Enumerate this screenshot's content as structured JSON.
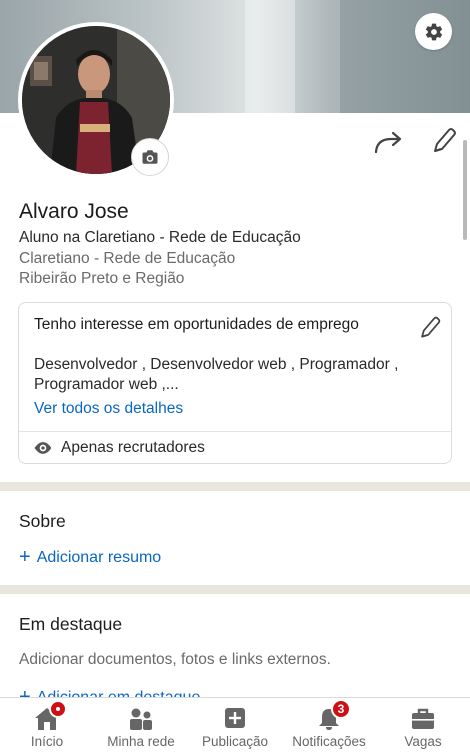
{
  "profile": {
    "name": "Alvaro Jose",
    "headline": "Aluno na Claretiano - Rede de Educação",
    "organization": "Claretiano - Rede de Educação",
    "location": "Ribeirão Preto e Região"
  },
  "open_to_work": {
    "title": "Tenho interesse em oportunidades de emprego",
    "roles": "Desenvolvedor , Desenvolvedor web , Programador , Programador web ,...",
    "details_link": "Ver todos os detalhes",
    "visibility": "Apenas recrutadores"
  },
  "about": {
    "title": "Sobre",
    "add_label": "Adicionar resumo"
  },
  "featured": {
    "title": "Em destaque",
    "description": "Adicionar documentos, fotos e links externos.",
    "add_label": "Adicionar em destaque"
  },
  "nav": {
    "items": [
      {
        "label": "Início",
        "icon": "home-icon"
      },
      {
        "label": "Minha rede",
        "icon": "network-icon"
      },
      {
        "label": "Publicação",
        "icon": "post-icon"
      },
      {
        "label": "Notificações",
        "icon": "bell-icon",
        "badge": "3"
      },
      {
        "label": "Vagas",
        "icon": "briefcase-icon"
      }
    ]
  },
  "colors": {
    "link": "#0a66c2",
    "badge": "#cc1016",
    "separator": "#e8e6df"
  }
}
